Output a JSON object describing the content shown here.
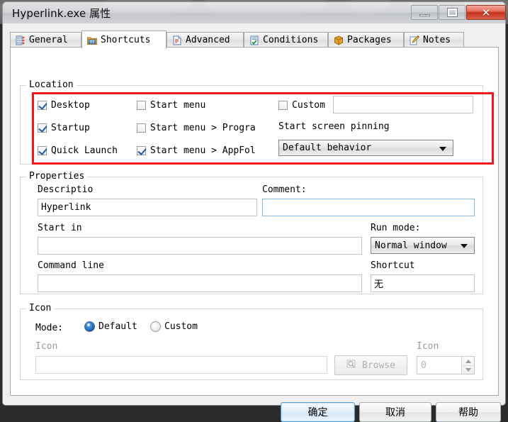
{
  "window": {
    "title": "Hyperlink.exe 属性",
    "controls": {
      "minimize": "minimize",
      "maximize": "maximize",
      "close": "✕"
    }
  },
  "tabs": [
    {
      "label": "General",
      "icon": "properties-list-icon",
      "active": false
    },
    {
      "label": "Shortcuts",
      "icon": "shortcuts-folder-icon",
      "active": true
    },
    {
      "label": "Advanced",
      "icon": "advanced-document-icon",
      "active": false
    },
    {
      "label": "Conditions",
      "icon": "conditions-check-icon",
      "active": false
    },
    {
      "label": "Packages",
      "icon": "packages-box-icon",
      "active": false
    },
    {
      "label": "Notes",
      "icon": "notes-pencil-icon",
      "active": false
    }
  ],
  "location": {
    "group_title": "Location",
    "checkboxes": [
      {
        "label": "Desktop",
        "checked": true
      },
      {
        "label": "Startup",
        "checked": true
      },
      {
        "label": "Quick Launch",
        "checked": true
      },
      {
        "label": "Start menu",
        "checked": false
      },
      {
        "label": "Start menu > Progra",
        "checked": false
      },
      {
        "label": "Start menu > AppFold",
        "checked": true
      },
      {
        "label": "Custom",
        "checked": false
      }
    ],
    "custom_path_value": "",
    "pinning_label": "Start screen pinning",
    "pinning_value": "Default behavior",
    "pinning_options": [
      "Default behavior"
    ]
  },
  "properties": {
    "group_title": "Properties",
    "description_label": "Descriptio",
    "description_value": "Hyperlink",
    "comment_label": "Comment:",
    "comment_value": "",
    "start_in_label": "Start in",
    "start_in_value": "",
    "command_line_label": "Command line",
    "command_line_value": "",
    "run_mode_label": "Run mode:",
    "run_mode_value": "Normal window",
    "run_mode_options": [
      "Normal window"
    ],
    "shortcut_label": "Shortcut",
    "shortcut_value": "无"
  },
  "icon_section": {
    "group_title": "Icon",
    "mode_label": "Mode:",
    "mode_default": "Default",
    "mode_custom": "Custom",
    "mode_selected": "Default",
    "icon_path_label": "Icon",
    "icon_path_value": "",
    "browse_label": "Browse",
    "icon_index_label": "Icon",
    "icon_index_value": "0"
  },
  "footer": {
    "ok": "确定",
    "cancel": "取消",
    "help": "帮助"
  },
  "annotation": {
    "highlight_color": "#f01818"
  }
}
